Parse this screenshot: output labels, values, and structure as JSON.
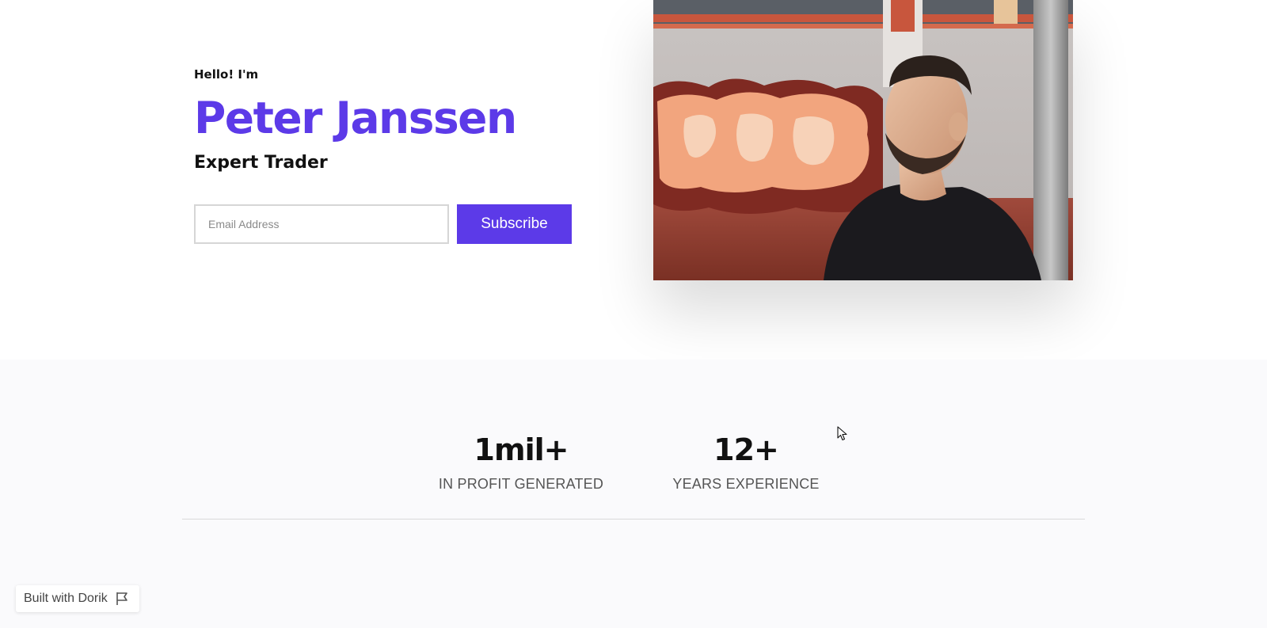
{
  "hero": {
    "greeting": "Hello! I'm",
    "name": "Peter Janssen",
    "role": "Expert Trader",
    "email_placeholder": "Email Address",
    "subscribe_label": "Subscribe",
    "photo_icon": "portrait-photo"
  },
  "stats": {
    "items": [
      {
        "value": "1mil+",
        "label": "IN PROFIT GENERATED"
      },
      {
        "value": "12+",
        "label": "YEARS EXPERIENCE"
      }
    ]
  },
  "badge": {
    "label": "Built with Dorik",
    "icon": "flag-icon"
  },
  "colors": {
    "accent": "#5c3ae8",
    "text": "#111111",
    "muted": "#555555",
    "stats_bg": "#fafafc"
  }
}
